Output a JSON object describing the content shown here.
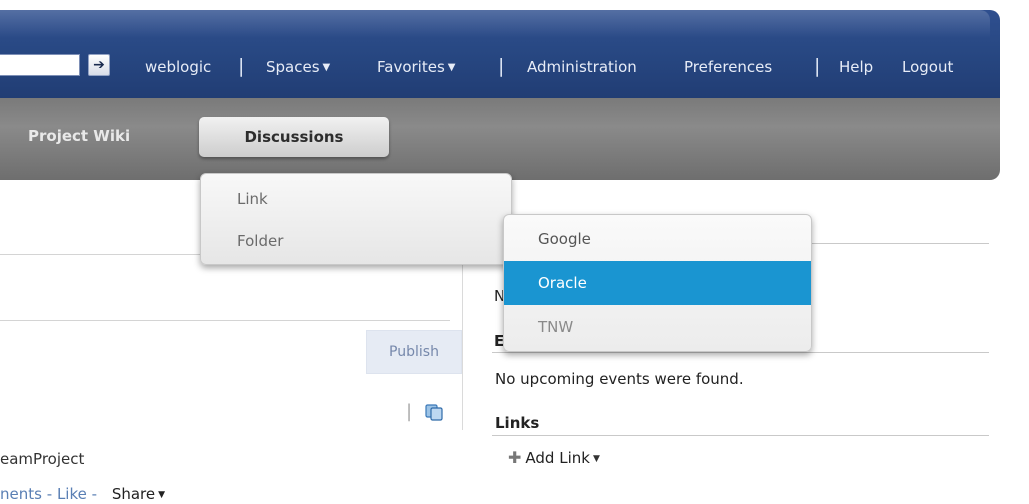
{
  "header": {
    "search": {
      "value": "",
      "placeholder": ""
    },
    "nav": {
      "user": "weblogic",
      "spaces": "Spaces",
      "favorites": "Favorites",
      "administration": "Administration",
      "preferences": "Preferences",
      "help": "Help",
      "logout": "Logout",
      "separator": "|"
    }
  },
  "tabs": {
    "project_wiki": "Project Wiki",
    "discussions": "Discussions"
  },
  "favorites_menu": {
    "items": [
      "Link",
      "Folder"
    ]
  },
  "submenu": {
    "items": [
      "Google",
      "Oracle",
      "TNW"
    ],
    "highlighted": "Oracle"
  },
  "main": {
    "publish_label": "Publish",
    "team_project": "eamProject",
    "actions": {
      "comments": "nents",
      "sep": "-",
      "like": "Like",
      "share": "Share"
    }
  },
  "right_panel": {
    "partial_1": "N",
    "partial_2": "E",
    "no_events": "No upcoming events were found.",
    "links_title": "Links",
    "add_link": "Add Link"
  },
  "icons": {
    "search_go": "arrow-right-icon",
    "copy": "copy-icon",
    "add": "plus-icon",
    "caret": "chevron-down-icon"
  },
  "colors": {
    "top_bar": "#284883",
    "highlight": "#1a95d1",
    "tab_bar": "#7a7a7a"
  }
}
